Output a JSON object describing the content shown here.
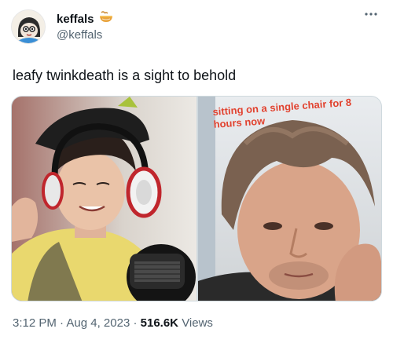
{
  "author": {
    "display_name": "keffals",
    "handle": "@keffals",
    "badge_icon": "ramen-bowl-icon"
  },
  "more_icon": "more-options-icon",
  "tweet": {
    "text": "leafy twinkdeath is a sight to behold"
  },
  "media": {
    "photos": [
      {
        "description_icon": "photo-left"
      },
      {
        "overlay_text": "sitting on a single chair for 8 hours now"
      }
    ]
  },
  "footer": {
    "time": "3:12 PM",
    "sep1": "·",
    "date": "Aug 4, 2023",
    "sep2": "·",
    "views_count": "516.6K",
    "views_label": "Views"
  },
  "colors": {
    "text_primary": "#0f1419",
    "text_secondary": "#536471",
    "border": "#cfd9de",
    "overlay_text": "#e0422f"
  }
}
